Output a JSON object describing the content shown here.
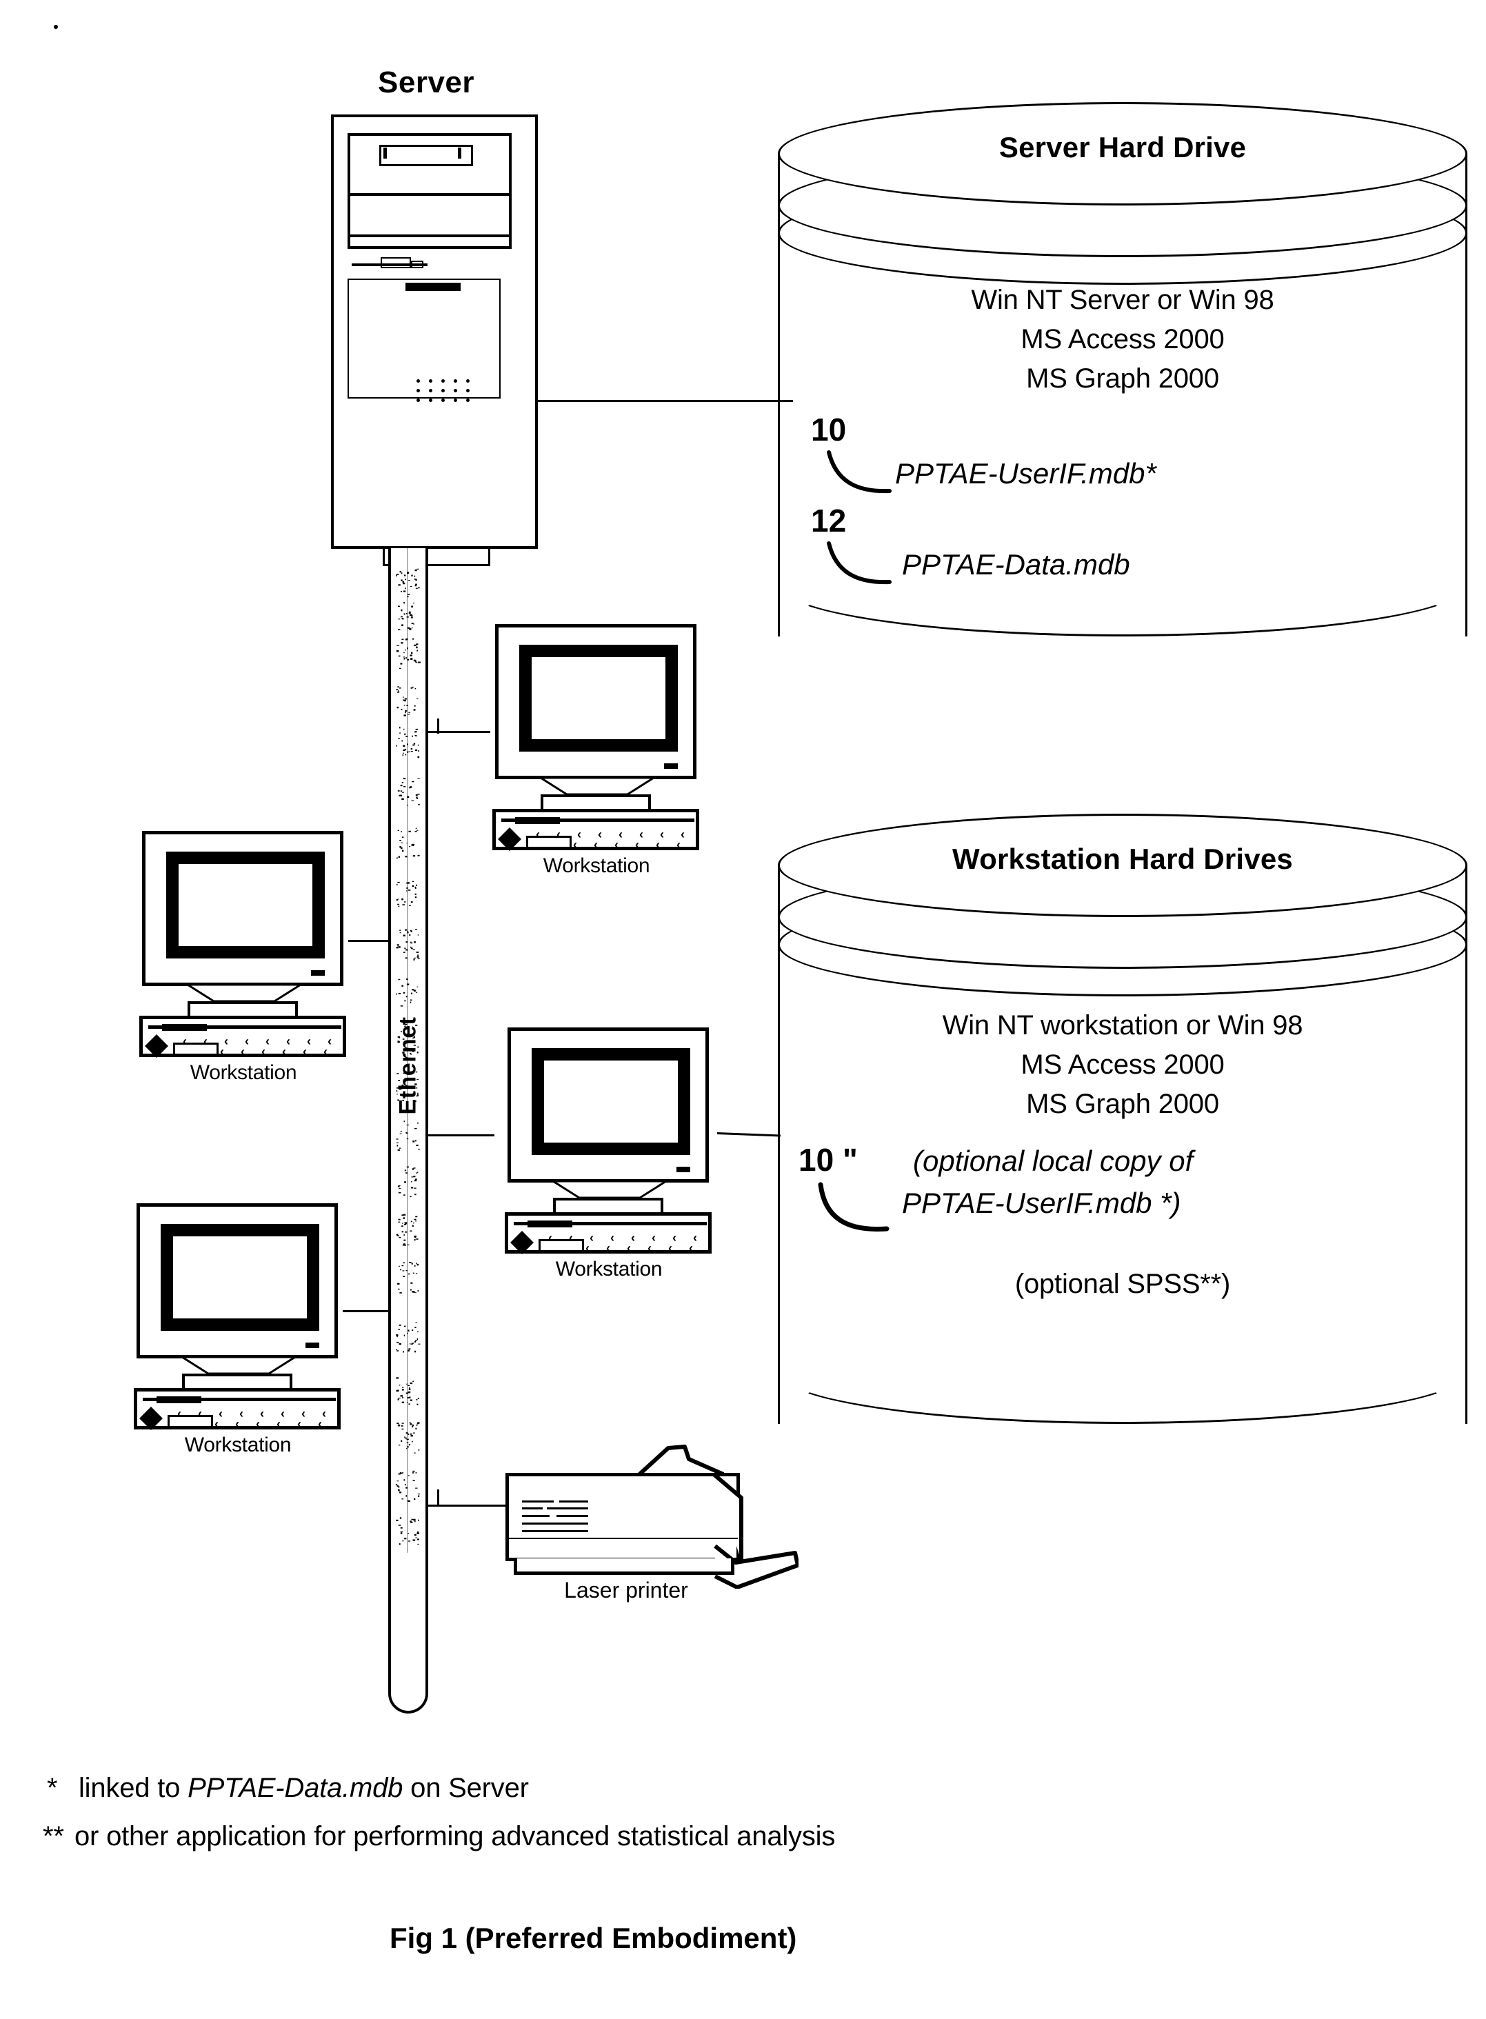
{
  "figure": {
    "caption": "Fig 1 (Preferred Embodiment)",
    "server_title": "Server"
  },
  "network": {
    "backbone_label": "Ethernet",
    "printer_label": "Laser printer",
    "workstation_label": "Workstation"
  },
  "server_hard_drive": {
    "title": "Server Hard Drive",
    "lines": [
      "Win NT Server or Win 98",
      "MS Access 2000",
      "MS Graph 2000"
    ],
    "refs": [
      {
        "number": "10",
        "text": "PPTAE-UserIF.mdb*"
      },
      {
        "number": "12",
        "text": "PPTAE-Data.mdb"
      }
    ]
  },
  "workstation_hard_drives": {
    "title": "Workstation Hard Drives",
    "lines": [
      "Win NT workstation or Win 98",
      "MS Access 2000",
      "MS Graph 2000"
    ],
    "refs": [
      {
        "number": "10 \"",
        "text_line_1": "(optional local copy of",
        "text_line_2": "PPTAE-UserIF.mdb *)"
      }
    ],
    "optional_note": "(optional SPSS**)"
  },
  "footnotes": [
    {
      "mark": "*",
      "text_plain_1": "linked to ",
      "text_italic": "PPTAE-Data.mdb",
      "text_plain_2": " on Server"
    },
    {
      "mark": "**",
      "text": "or other application for performing advanced statistical analysis"
    }
  ],
  "workstations": [
    {
      "label": "Workstation"
    },
    {
      "label": "Workstation"
    },
    {
      "label": "Workstation"
    },
    {
      "label": "Workstation"
    }
  ],
  "colors": {
    "ink": "#000000",
    "paper": "#ffffff"
  }
}
